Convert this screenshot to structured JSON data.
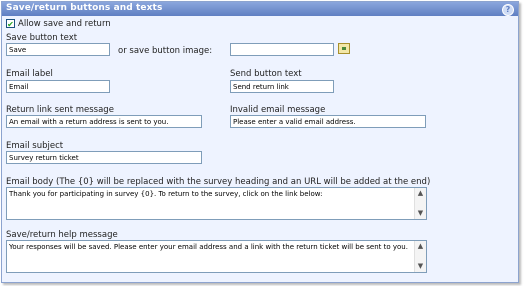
{
  "header": {
    "title": "Save/return buttons and texts",
    "help_icon": "?"
  },
  "allow_save": {
    "label": "Allow save and return",
    "checked": true,
    "check_glyph": "✔"
  },
  "save_button": {
    "label": "Save button text",
    "value": "Save",
    "or_image_label": "or save button image:",
    "image_value": ""
  },
  "email_label": {
    "label": "Email label",
    "value": "Email"
  },
  "send_button": {
    "label": "Send button text",
    "value": "Send return link"
  },
  "return_link_msg": {
    "label": "Return link sent message",
    "value": "An email with a return address is sent to you."
  },
  "invalid_email_msg": {
    "label": "Invalid email message",
    "value": "Please enter a valid email address."
  },
  "email_subject": {
    "label": "Email subject",
    "value": "Survey return ticket"
  },
  "email_body": {
    "label": "Email body (The {0} will be replaced with the survey heading and an URL will be added at the end)",
    "value": "Thank you for participating in survey {0}. To return to the survey, click on the link below:"
  },
  "help_message": {
    "label": "Save/return help message",
    "value": "Your responses will be saved. Please enter your email address and a link with the return ticket will be sent to you."
  },
  "scroll": {
    "up": "▲",
    "down": "▼"
  }
}
